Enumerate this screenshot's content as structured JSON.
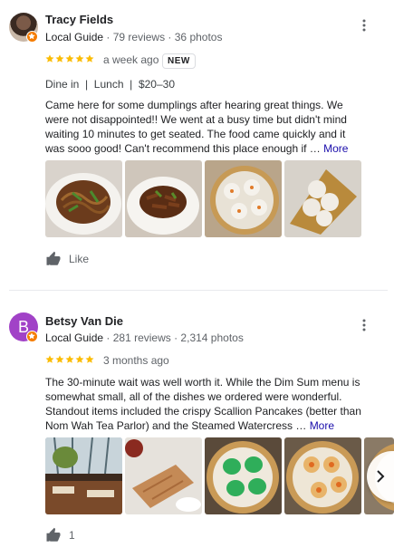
{
  "reviews": [
    {
      "name": "Tracy Fields",
      "badge": "Local Guide",
      "stats": "79 reviews · 36 photos",
      "rating": 5,
      "when": "a week ago",
      "new_label": "NEW",
      "tags": "Dine in  |  Lunch  |  $20–30",
      "text": "Came here for some dumplings after hearing great things. We were not disappointed!! We went at a busy time but didn't mind waiting 10 minutes to get seated. The food came quickly and it was sooo good! Can't recommend this place enough if …",
      "more": "More",
      "like_label": "Like",
      "photos": [
        "noodles-dish-photo",
        "beef-dish-photo",
        "soup-dumplings-photo",
        "buns-photo"
      ]
    },
    {
      "name": "Betsy Van Die",
      "initial": "B",
      "badge": "Local Guide",
      "stats": "281 reviews · 2,314 photos",
      "rating": 5,
      "when": "3 months ago",
      "text": "The 30-minute wait was well worth it. While the Dim Sum menu is somewhat small, all of the dishes we ordered were wonderful. Standout items included the crispy Scallion Pancakes (better than Nom Wah Tea Parlor) and the Steamed Watercress …",
      "more": "More",
      "like_count": "1",
      "photos": [
        "restaurant-interior-photo",
        "scallion-pancake-photo",
        "green-dumplings-photo",
        "shumai-photo",
        "dumplings-partial-photo"
      ]
    }
  ],
  "colors": {
    "star": "#fbbc04",
    "guide_badge": "#f57c00",
    "avatar_letter_bg": "#a142c7",
    "link": "#1a0dab"
  }
}
